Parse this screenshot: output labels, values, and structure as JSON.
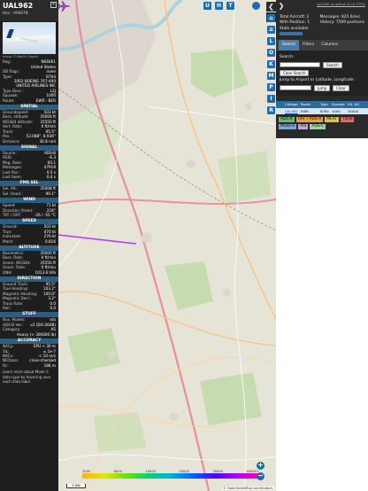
{
  "info": {
    "callsign": "UAL962",
    "hex_line": "Hex : A9667B",
    "photo_credit": "Image © Martin Oswald",
    "basic": [
      {
        "label": "Reg.:",
        "value": "N66061",
        "link": true
      },
      {
        "label": "",
        "value": "United States"
      },
      {
        "label": "DB flags:",
        "value": "none"
      },
      {
        "label": "Type:",
        "value": "B764"
      },
      {
        "label": "",
        "value": "2002 BOEING 767-400"
      },
      {
        "label": "",
        "value": "UNITED AIRLINES INC"
      },
      {
        "label": "Type Desc.:",
        "value": "L2J"
      },
      {
        "label": "Squawk:",
        "value": "1000"
      },
      {
        "label": "Route:",
        "value": "EWR - BER"
      }
    ],
    "sections": [
      {
        "title": "SPATIAL",
        "rows": [
          {
            "label": "Groundspeed:",
            "value": "503 kt"
          },
          {
            "label": "Baro. altitude:",
            "value": "35000 ft"
          },
          {
            "label": "WGS84 altitude:",
            "value": "35550 ft"
          },
          {
            "label": "Vert. Rate:",
            "value": "0 ft/min"
          },
          {
            "label": "Track:",
            "value": "95.5°"
          },
          {
            "label": "Pos.:",
            "value": "53.088°, 8.936°"
          },
          {
            "label": "Distance:",
            "value": "36.8 nmi"
          }
        ]
      },
      {
        "title": "SIGNAL",
        "rows": [
          {
            "label": "Source:",
            "value": "ADS-B"
          },
          {
            "label": "RSSI:",
            "value": "-6.3"
          },
          {
            "label": "Msg. Rate:",
            "value": "60.1"
          },
          {
            "label": "Messages:",
            "value": "47919"
          },
          {
            "label": "Last Pos.:",
            "value": "0.5 s"
          },
          {
            "label": "Last Seen:",
            "value": "0.4 s"
          }
        ]
      },
      {
        "title": "FMS SEL",
        "rows": [
          {
            "label": "Sel. Alt.:",
            "value": "35008 ft"
          },
          {
            "label": "Sel. Head.:",
            "value": "99.1°"
          }
        ]
      },
      {
        "title": "WIND",
        "rows": [
          {
            "label": "Speed:",
            "value": "71 kt"
          },
          {
            "label": "Direction (from):",
            "value": "216°"
          },
          {
            "label": "TAT / OAT:",
            "value": "-26 / -55 °C"
          }
        ]
      },
      {
        "title": "SPEED",
        "rows": [
          {
            "label": "Ground:",
            "value": "503 kt"
          },
          {
            "label": "True:",
            "value": "470 kt"
          },
          {
            "label": "Indicated:",
            "value": "276 kt"
          },
          {
            "label": "Mach:",
            "value": "0.816"
          }
        ]
      },
      {
        "title": "ALTITUDE",
        "rows": [
          {
            "label": "Barometric:",
            "value": "35000 ft"
          },
          {
            "label": "Baro. Rate:",
            "value": "0 ft/min"
          },
          {
            "label": "Geom. WGS84:",
            "value": "35550 ft"
          },
          {
            "label": "Geom. Rate:",
            "value": "0 ft/min"
          },
          {
            "label": "QNH:",
            "value": "1013.6 hPa"
          }
        ]
      },
      {
        "title": "DIRECTION",
        "rows": [
          {
            "label": "Ground Track:",
            "value": "95.5°"
          },
          {
            "label": "True Heading:",
            "value": "103.2°"
          },
          {
            "label": "Magnetic Heading:",
            "value": "100.0°"
          },
          {
            "label": "Magnetic Decl.:",
            "value": "3.2°"
          },
          {
            "label": "Track Rate:",
            "value": "0.0"
          },
          {
            "label": "Roll:",
            "value": "0.0"
          }
        ]
      },
      {
        "title": "STUFF",
        "rows": [
          {
            "label": "Nav. Modes:",
            "value": "n/a"
          },
          {
            "label": "ADS-B Ver.:",
            "value": "v2 (DO-260B)"
          },
          {
            "label": "Category:",
            "value": "A5"
          }
        ],
        "extra": "Heavy (> 300000 lb)"
      },
      {
        "title": "ACCURACY",
        "rows": [
          {
            "label": "NACp:",
            "value": "EPU < 30 m"
          },
          {
            "label": "SIL:",
            "value": "≤ 1e-7"
          },
          {
            "label": "NACv:",
            "value": "< 10 m/s"
          },
          {
            "label": "NICbaro:",
            "value": "cross-checked"
          },
          {
            "label": "Rc:",
            "value": "186 m"
          }
        ]
      }
    ],
    "note": "Learn more about Mode S data type by hovering over each data label."
  },
  "map": {
    "buttons_right": [
      "U",
      "H",
      "T"
    ],
    "buttons_col": [
      "L",
      "O",
      "K",
      "M",
      "P",
      "I",
      "R"
    ],
    "scale_labels": [
      "2000",
      "6000",
      "10000",
      "20000",
      "30000",
      "40000+"
    ],
    "scalebar": "5 NM",
    "attribution": "© OpenStreetMap contributors.",
    "zoom_in": "+",
    "zoom_out": "−",
    "prev_toggle": "❮",
    "next_toggle": "❯"
  },
  "sidebar": {
    "top_link": "tar1090 on github (3.14.1753)",
    "stats_left": [
      "Total Aircraft: 1",
      "With Position: 1",
      "Stats available"
    ],
    "stats_right": [
      "Messages: 825.6/sec",
      "History: 7569 positions"
    ],
    "tabs": [
      "Search",
      "Filters",
      "Columns"
    ],
    "search_label": "Search:",
    "search_button": "Search",
    "clear_search": "Clear Search",
    "jump_label": "Jump to Airport or Latitude, Longitude:",
    "jump_button": "Jump",
    "clear_button": "Clear",
    "table_headers": [
      "",
      "Callsign",
      "Route",
      "Type",
      "Squawk",
      "Alt. (ft)"
    ],
    "table_row": [
      "",
      "UAL962",
      "EWR - BER",
      "B764",
      "1000",
      "35000"
    ],
    "badges": [
      {
        "label": "ADS-B",
        "color": "#6bb86b"
      },
      {
        "label": "UAT / ADS-R",
        "color": "#e6a040"
      },
      {
        "label": "MLAT",
        "color": "#e0c040"
      },
      {
        "label": "TIS-B",
        "color": "#e06666"
      },
      {
        "label": "Mode-S",
        "color": "#7aa7d6"
      },
      {
        "label": "AIS",
        "color": "#c7a6d8"
      },
      {
        "label": "ADS-C",
        "color": "#9fd29f"
      }
    ]
  }
}
